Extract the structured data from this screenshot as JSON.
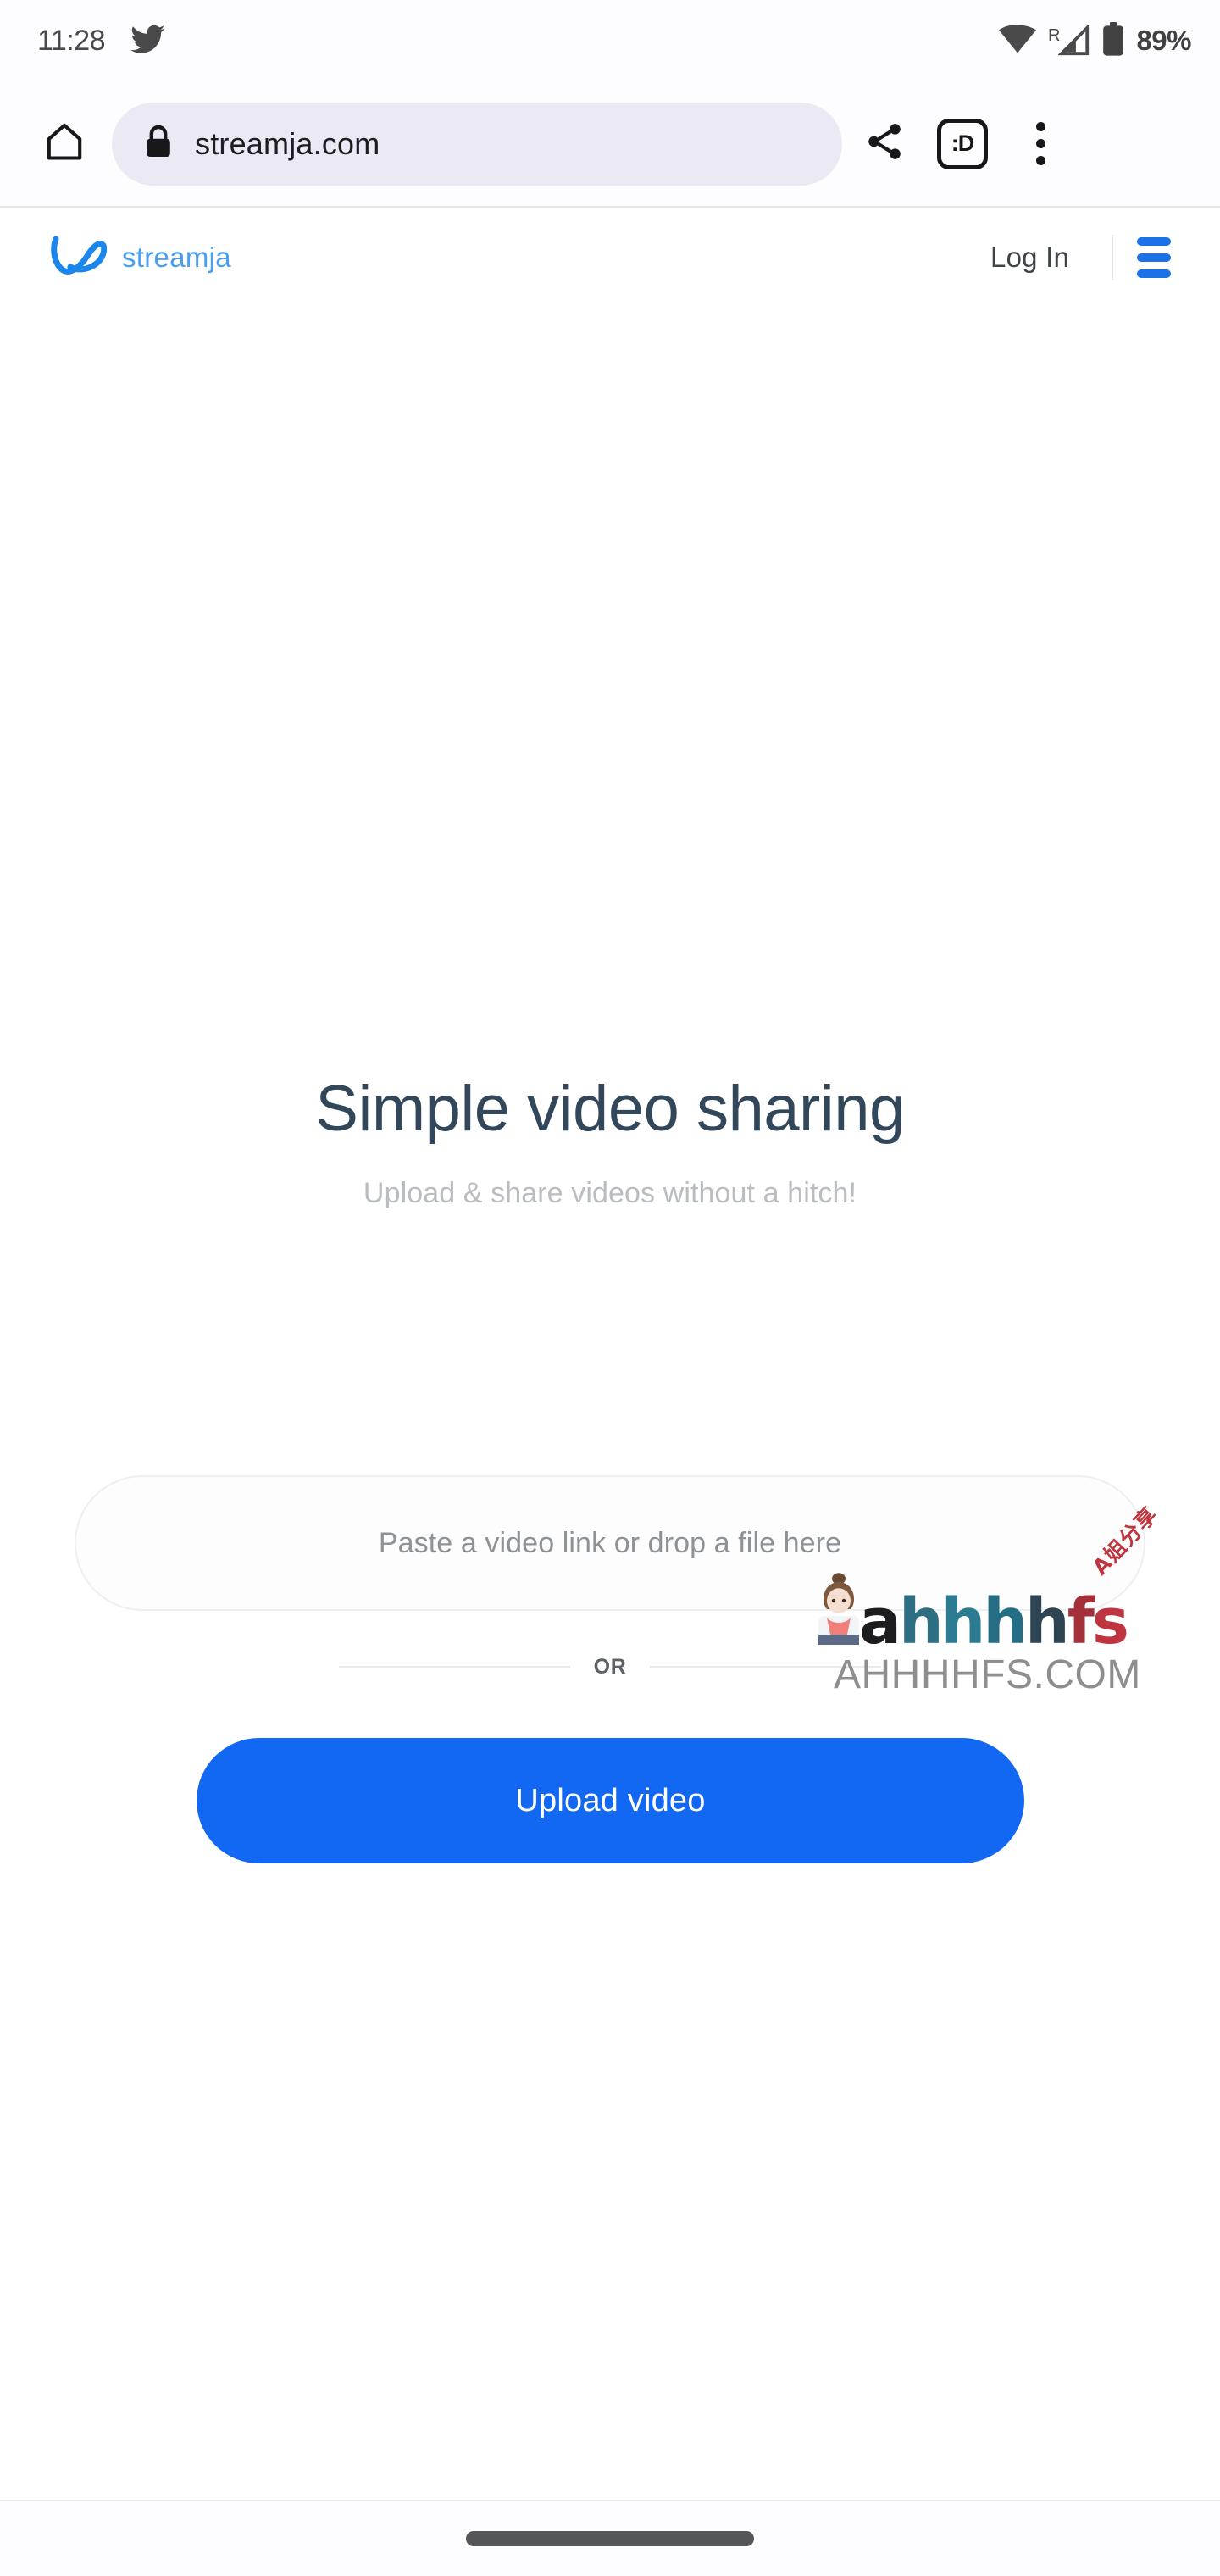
{
  "status_bar": {
    "time": "11:28",
    "notification_icon": "twitter-bird-icon",
    "wifi_icon": "wifi-icon",
    "roaming_label": "R",
    "signal_icon": "cellular-signal-icon",
    "battery_icon": "battery-icon",
    "battery_percent": "89%"
  },
  "browser": {
    "home_icon": "home-icon",
    "lock_icon": "lock-icon",
    "url": "streamja.com",
    "share_icon": "share-icon",
    "tab_count_label": ":D",
    "menu_icon": "kebab-menu-icon"
  },
  "site_header": {
    "logo_icon": "streamja-bow-logo-icon",
    "brand": "streamja",
    "login_label": "Log In",
    "menu_icon": "hamburger-menu-icon"
  },
  "hero": {
    "title": "Simple video sharing",
    "subtitle": "Upload & share videos without a hitch!"
  },
  "upload": {
    "dropzone_placeholder": "Paste a video link or drop a file here",
    "dropzone_value": "",
    "divider_label": "OR",
    "button_label": "Upload video"
  },
  "watermark": {
    "script_letters": [
      "a",
      "h",
      "h",
      "h",
      "h",
      "f",
      "s"
    ],
    "cn_text": "A姐分享",
    "domain": "AHHHHFS.COM"
  },
  "navigation_bar": {
    "gesture_pill": "home-gesture-pill"
  },
  "colors": {
    "brand_blue": "#4a9df0",
    "accent_blue": "#1268f3",
    "menu_blue": "#1b72e8",
    "heading": "#33475b",
    "muted": "#b9bdc2",
    "omnibox_bg": "#ebe9f4"
  }
}
